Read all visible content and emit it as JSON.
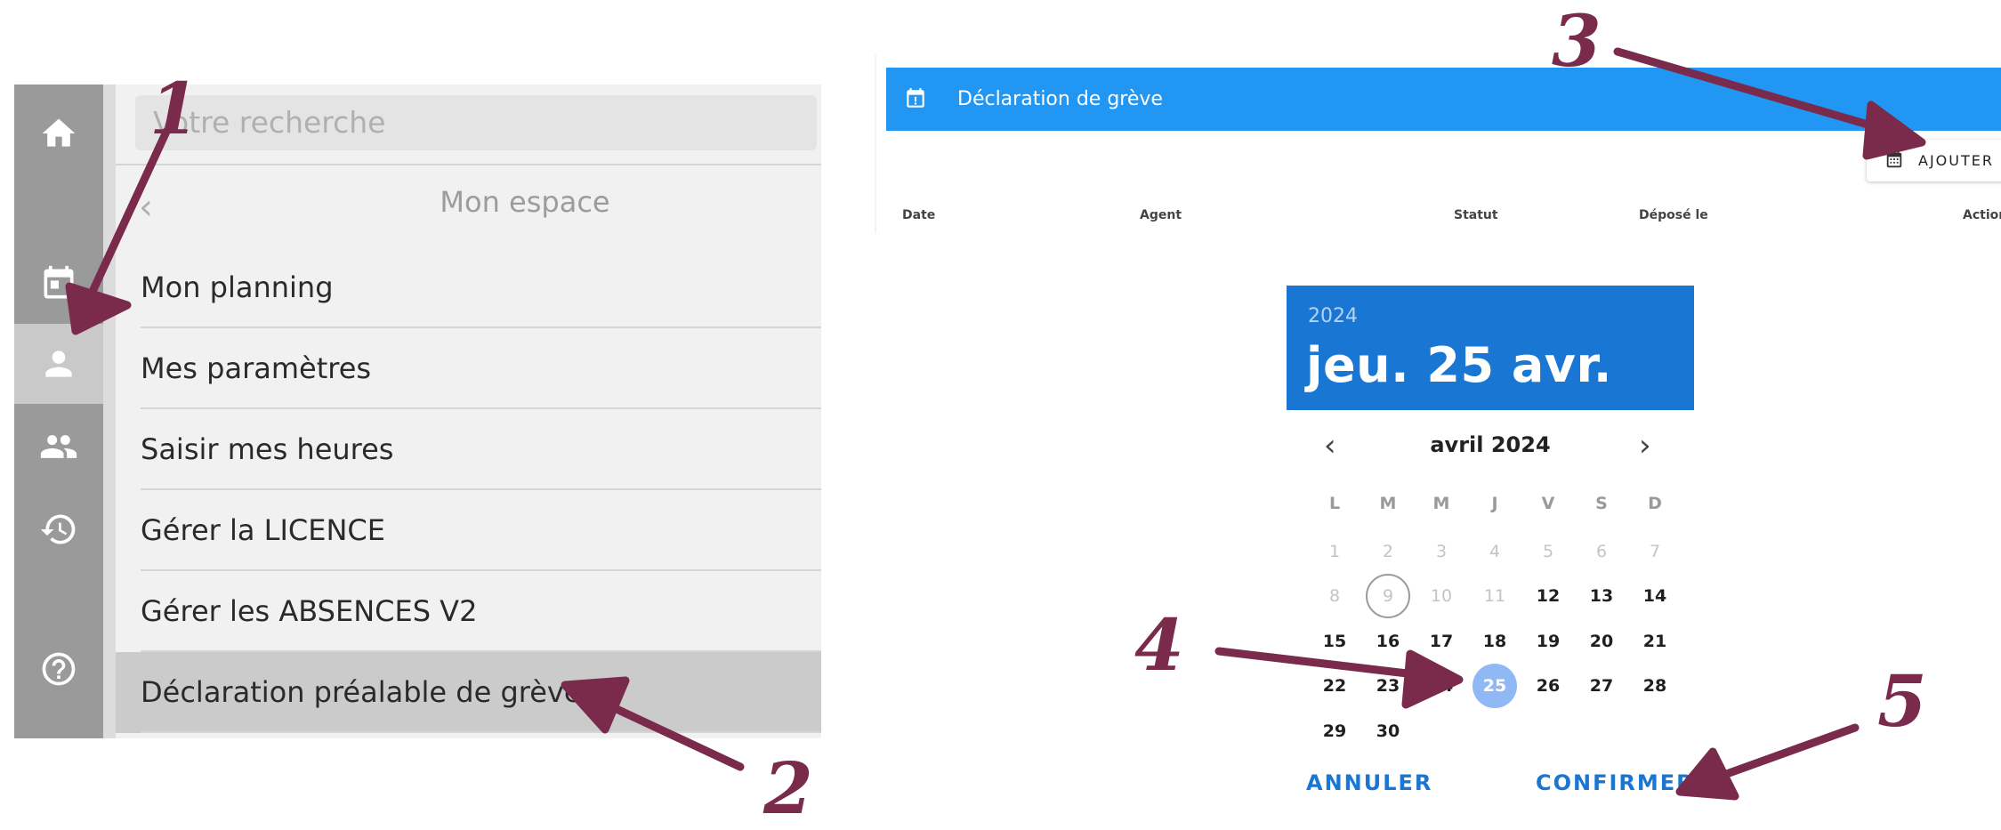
{
  "left_menu": {
    "rail_icons": [
      "home-icon",
      "calendar-icon",
      "person-icon",
      "group-icon",
      "history-icon",
      "help-icon"
    ],
    "search_placeholder": "Votre recherche",
    "section_title": "Mon espace",
    "items": [
      {
        "label": "Mon planning"
      },
      {
        "label": "Mes paramètres"
      },
      {
        "label": "Saisir mes heures"
      },
      {
        "label": "Gérer la LICENCE"
      },
      {
        "label": "Gérer les ABSENCES V2"
      },
      {
        "label": "Déclaration préalable de grève"
      }
    ]
  },
  "app_bar": {
    "title": "Déclaration de grève"
  },
  "toolbar": {
    "add_label": "AJOUTER"
  },
  "table": {
    "headers": [
      "Date",
      "Agent",
      "Statut",
      "Déposé le",
      "Action"
    ]
  },
  "date_picker": {
    "year": "2024",
    "selected_label": "jeu. 25 avr.",
    "month_label": "avril 2024",
    "weekdays": [
      "L",
      "M",
      "M",
      "J",
      "V",
      "S",
      "D"
    ],
    "days": [
      "1",
      "2",
      "3",
      "4",
      "5",
      "6",
      "7",
      "8",
      "9",
      "10",
      "11",
      "12",
      "13",
      "14",
      "15",
      "16",
      "17",
      "18",
      "19",
      "20",
      "21",
      "22",
      "23",
      "24",
      "25",
      "26",
      "27",
      "28",
      "29",
      "30"
    ],
    "disabled_through": 11,
    "today": 9,
    "selected": 25,
    "cancel_label": "ANNULER",
    "confirm_label": "CONFIRMER"
  },
  "annotations": [
    "1",
    "2",
    "3",
    "4",
    "5"
  ],
  "colors": {
    "app_bar": "#2196f3",
    "picker_header": "#1976d2",
    "annotation": "#7a2a4a",
    "selected_day": "#8fb8f5"
  }
}
